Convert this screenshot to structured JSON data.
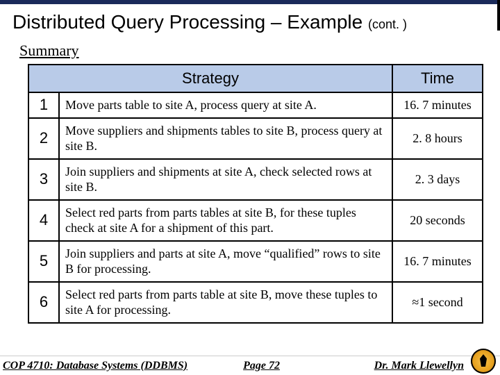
{
  "title": {
    "main": "Distributed Query Processing – Example ",
    "cont": "(cont. )"
  },
  "subtitle": "Summary",
  "header": {
    "strategy": "Strategy",
    "time": "Time"
  },
  "rows": [
    {
      "n": "1",
      "strategy": "Move parts table to site A, process query at site A.",
      "time": "16. 7 minutes"
    },
    {
      "n": "2",
      "strategy": "Move suppliers and shipments tables to site B, process query at site B.",
      "time": "2. 8  hours"
    },
    {
      "n": "3",
      "strategy": "Join suppliers and shipments at site A, check selected rows at site B.",
      "time": "2. 3 days"
    },
    {
      "n": "4",
      "strategy": "Select red parts from parts tables at site B, for these tuples check at site A for a shipment of this part.",
      "time": "20 seconds"
    },
    {
      "n": "5",
      "strategy": "Join suppliers and parts at site A, move “qualified” rows to site B for processing.",
      "time": "16. 7 minutes"
    },
    {
      "n": "6",
      "strategy": "Select red parts from parts table at site B, move these tuples to site A for processing.",
      "time": "≈1 second"
    }
  ],
  "footer": {
    "course": "COP 4710: Database Systems  (DDBMS)",
    "page": "Page 72",
    "author": "Dr. Mark Llewellyn"
  }
}
